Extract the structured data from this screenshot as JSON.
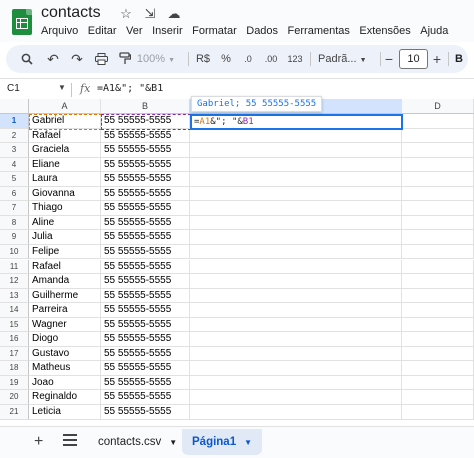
{
  "app": {
    "title": "contacts",
    "title_icons": [
      "star-icon",
      "move-folder-icon",
      "cloud-status-icon"
    ]
  },
  "menu": [
    "Arquivo",
    "Editar",
    "Ver",
    "Inserir",
    "Formatar",
    "Dados",
    "Ferramentas",
    "Extensões",
    "Ajuda"
  ],
  "toolbar": {
    "zoom": "100%",
    "currency": "R$",
    "percent": "%",
    "dec_decrease": ".0",
    "dec_increase": ".00",
    "number_format": "123",
    "font": "Padrã...",
    "font_size": "10",
    "bold": "B",
    "minus": "−",
    "plus": "+"
  },
  "formula_bar": {
    "name_box": "C1",
    "fx": "fx",
    "formula": "=A1&\"; \"&B1"
  },
  "columns": [
    "A",
    "B",
    "C",
    "D"
  ],
  "rows": [
    {
      "n": "1",
      "a": "Gabriel",
      "b": "55 55555-5555"
    },
    {
      "n": "2",
      "a": "Rafael",
      "b": "55 55555-5555"
    },
    {
      "n": "3",
      "a": "Graciela",
      "b": "55 55555-5555"
    },
    {
      "n": "4",
      "a": "Eliane",
      "b": "55 55555-5555"
    },
    {
      "n": "5",
      "a": "Laura",
      "b": "55 55555-5555"
    },
    {
      "n": "6",
      "a": "Giovanna",
      "b": "55 55555-5555"
    },
    {
      "n": "7",
      "a": "Thiago",
      "b": "55 55555-5555"
    },
    {
      "n": "8",
      "a": "Aline",
      "b": "55 55555-5555"
    },
    {
      "n": "9",
      "a": "Julia",
      "b": "55 55555-5555"
    },
    {
      "n": "10",
      "a": "Felipe",
      "b": "55 55555-5555"
    },
    {
      "n": "11",
      "a": "Rafael",
      "b": "55 55555-5555"
    },
    {
      "n": "12",
      "a": "Amanda",
      "b": "55 55555-5555"
    },
    {
      "n": "13",
      "a": "Guilherme",
      "b": "55 55555-5555"
    },
    {
      "n": "14",
      "a": "Parreira",
      "b": "55 55555-5555"
    },
    {
      "n": "15",
      "a": "Wagner",
      "b": "55 55555-5555"
    },
    {
      "n": "16",
      "a": "Diogo",
      "b": "55 55555-5555"
    },
    {
      "n": "17",
      "a": "Gustavo",
      "b": "55 55555-5555"
    },
    {
      "n": "18",
      "a": "Matheus",
      "b": "55 55555-5555"
    },
    {
      "n": "19",
      "a": "Joao",
      "b": "55 55555-5555"
    },
    {
      "n": "20",
      "a": "Reginaldo",
      "b": "55 55555-5555"
    },
    {
      "n": "21",
      "a": "Leticia",
      "b": "55 55555-5555"
    }
  ],
  "editing": {
    "tooltip": "Gabriel; 55 55555-5555",
    "ref_a": "A1",
    "ref_b": "B1",
    "mid": "&\"; \"&",
    "prefix": "="
  },
  "sheets": {
    "add": "+",
    "tabs": [
      {
        "label": "contacts.csv",
        "active": false
      },
      {
        "label": "Página1",
        "active": true
      }
    ]
  },
  "colors": {
    "accent": "#0b57d0",
    "ref_a": "#e37400",
    "ref_b": "#8e24aa",
    "brand": "#1e8e3e"
  }
}
